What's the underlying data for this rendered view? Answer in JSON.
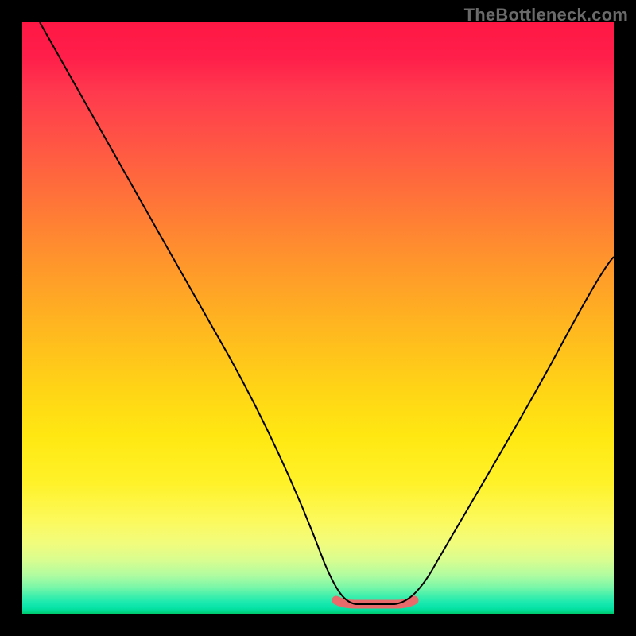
{
  "watermark": "TheBottleneck.com",
  "colors": {
    "frame": "#000000",
    "line": "#000000",
    "band": "#e86a6a",
    "gradient_top": "#ff1744",
    "gradient_bottom": "#00c86a"
  },
  "chart_data": {
    "type": "line",
    "title": "",
    "xlabel": "",
    "ylabel": "",
    "xlim": [
      0,
      100
    ],
    "ylim": [
      0,
      100
    ],
    "grid": false,
    "legend": {
      "visible": false
    },
    "series": [
      {
        "name": "bottleneck-curve",
        "x": [
          3,
          10,
          18,
          26,
          34,
          42,
          46,
          50,
          53,
          55,
          57,
          60,
          63,
          66,
          70,
          76,
          82,
          88,
          94,
          100
        ],
        "values": [
          100,
          88,
          75,
          62,
          48,
          33,
          24,
          14,
          7,
          3,
          2,
          2,
          2,
          4,
          8,
          17,
          27,
          38,
          49,
          60
        ]
      }
    ],
    "annotations": [
      {
        "name": "optimal-band",
        "type": "segment",
        "x": [
          53,
          66
        ],
        "values": [
          2,
          2
        ]
      }
    ]
  }
}
